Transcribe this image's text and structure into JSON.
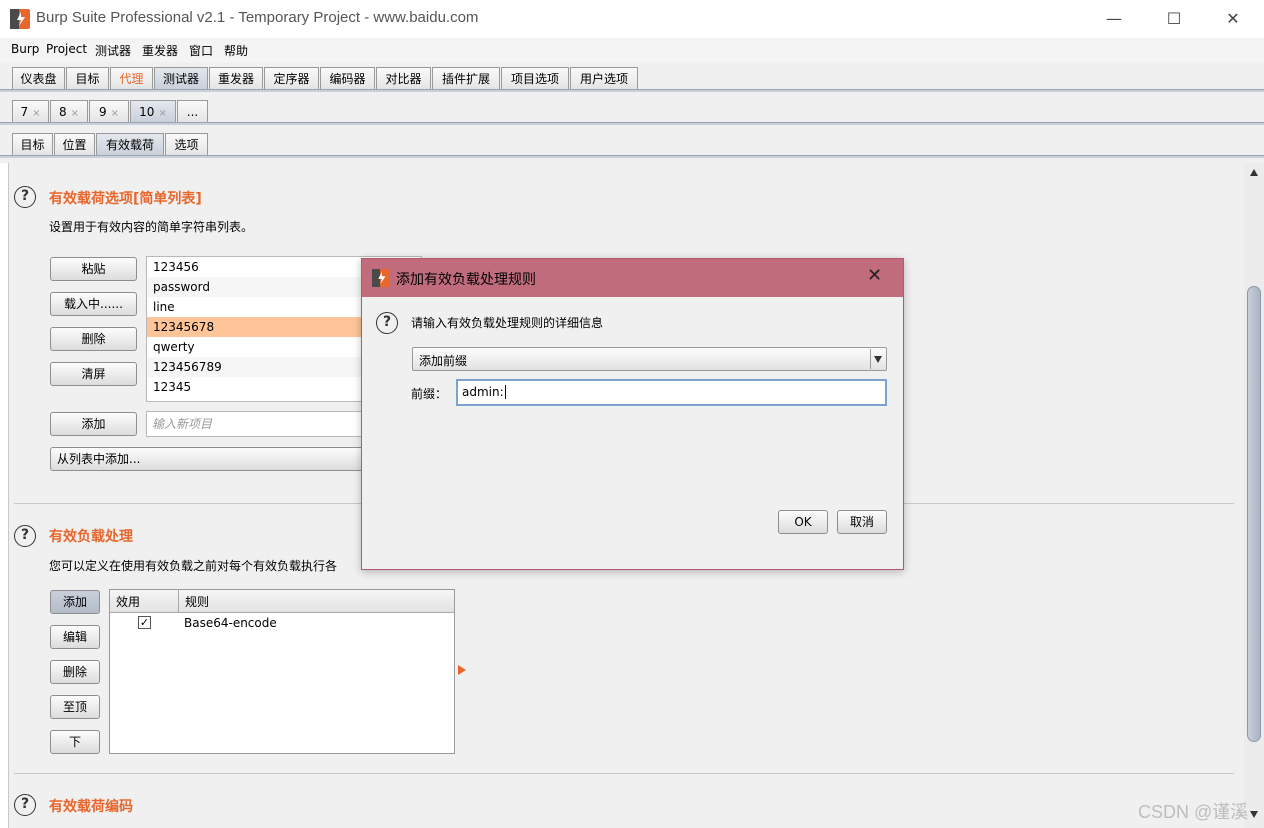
{
  "window": {
    "title": "Burp Suite Professional v2.1 - Temporary Project - www.baidu.com",
    "minimize": "—",
    "maximize": "☐",
    "close": "✕"
  },
  "menu": [
    "Burp",
    "Project",
    "测试器",
    "重发器",
    "窗口",
    "帮助"
  ],
  "main_tabs": [
    {
      "label": "仪表盘"
    },
    {
      "label": "目标"
    },
    {
      "label": "代理"
    },
    {
      "label": "测试器"
    },
    {
      "label": "重发器"
    },
    {
      "label": "定序器"
    },
    {
      "label": "编码器"
    },
    {
      "label": "对比器"
    },
    {
      "label": "插件扩展"
    },
    {
      "label": "项目选项"
    },
    {
      "label": "用户选项"
    }
  ],
  "attack_tabs": [
    {
      "label": "7",
      "close": "×"
    },
    {
      "label": "8",
      "close": "×"
    },
    {
      "label": "9",
      "close": "×"
    },
    {
      "label": "10",
      "close": "×"
    },
    {
      "label": "..."
    }
  ],
  "sub_tabs": [
    {
      "label": "目标"
    },
    {
      "label": "位置"
    },
    {
      "label": "有效载荷"
    },
    {
      "label": "选项"
    }
  ],
  "payload_options": {
    "title": "有效载荷选项[简单列表]",
    "description": "设置用于有效内容的简单字符串列表。",
    "buttons": {
      "paste": "粘贴",
      "load": "载入中......",
      "remove": "删除",
      "clear": "清屏",
      "add": "添加",
      "add_from_list": "从列表中添加..."
    },
    "items": [
      "123456",
      "password",
      "line",
      "12345678",
      "qwerty",
      "123456789",
      "12345"
    ],
    "selected_index": 3,
    "new_item_placeholder": "输入新项目"
  },
  "payload_processing": {
    "title": "有效负载处理",
    "description": "您可以定义在使用有效负载之前对每个有效负载执行各",
    "buttons": {
      "add": "添加",
      "edit": "编辑",
      "remove": "删除",
      "up": "至顶",
      "down": "下"
    },
    "columns": [
      "效用",
      "规则"
    ],
    "rules": [
      {
        "enabled": true,
        "rule": "Base64-encode"
      }
    ]
  },
  "payload_encoding": {
    "title": "有效载荷编码"
  },
  "dialog": {
    "title": "添加有效负载处理规则",
    "prompt": "请输入有效负载处理规则的详细信息",
    "select_value": "添加前缀",
    "prefix_label": "前缀：",
    "prefix_value": "admin:",
    "ok": "OK",
    "cancel": "取消"
  },
  "watermark": "CSDN @谨溪",
  "colors": {
    "accent": "#e8672c",
    "dialog_title_bg": "#c06c7c",
    "selection": "#ffc599"
  }
}
